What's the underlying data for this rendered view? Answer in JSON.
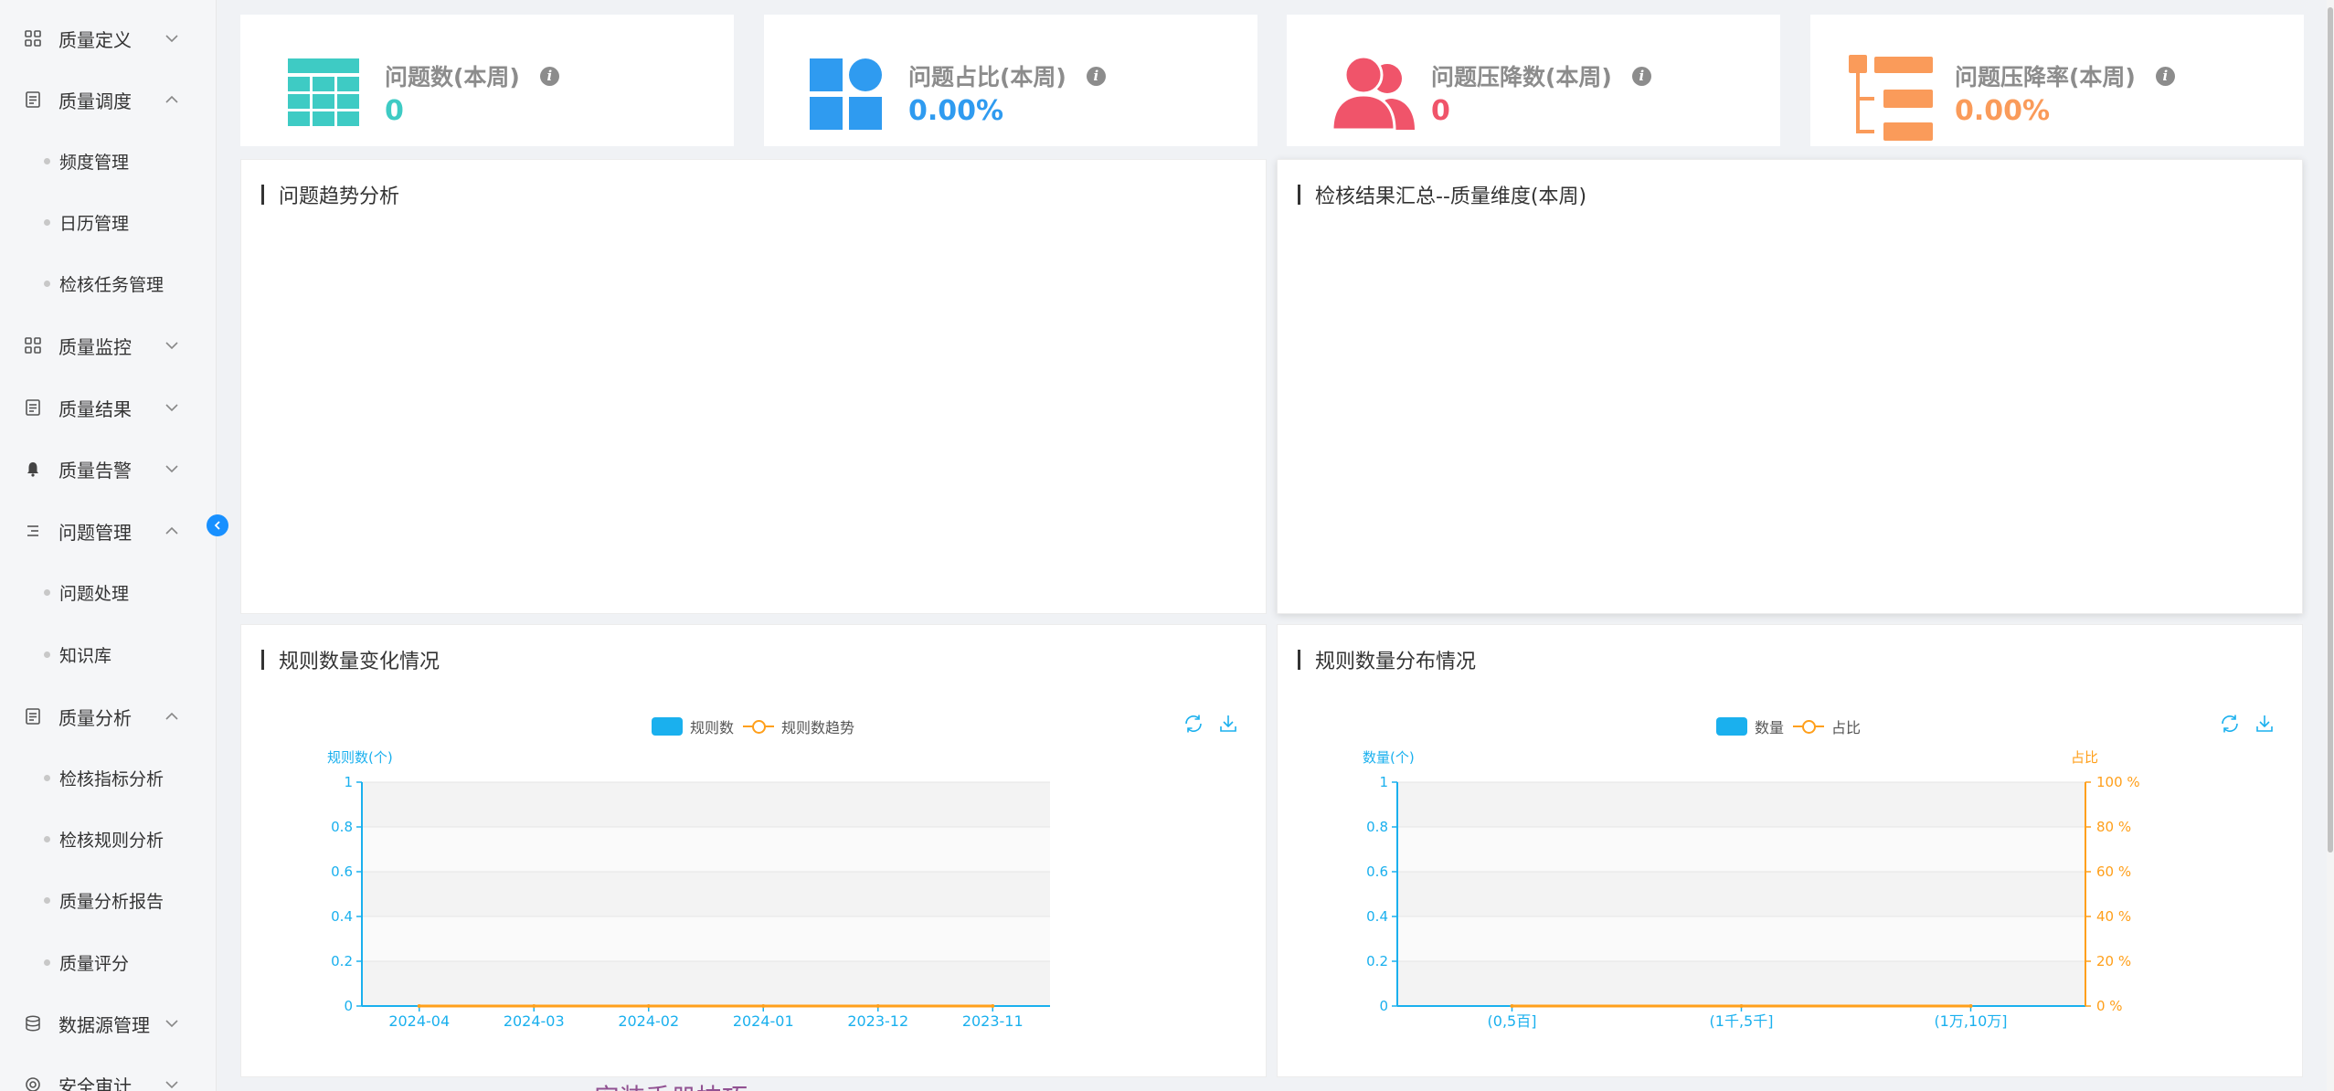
{
  "sidebar": {
    "items": [
      {
        "label": "质量定义",
        "icon": "grid-icon",
        "expanded": false
      },
      {
        "label": "质量调度",
        "icon": "document-icon",
        "expanded": true,
        "children": [
          "频度管理",
          "日历管理",
          "检核任务管理"
        ]
      },
      {
        "label": "质量监控",
        "icon": "grid-icon",
        "expanded": false
      },
      {
        "label": "质量结果",
        "icon": "document-icon",
        "expanded": false
      },
      {
        "label": "质量告警",
        "icon": "bell-icon",
        "expanded": false
      },
      {
        "label": "问题管理",
        "icon": "list-indent-icon",
        "expanded": true,
        "children": [
          "问题处理",
          "知识库"
        ]
      },
      {
        "label": "质量分析",
        "icon": "document-icon",
        "expanded": true,
        "children": [
          "检核指标分析",
          "检核规则分析",
          "质量分析报告",
          "质量评分"
        ]
      },
      {
        "label": "数据源管理",
        "icon": "database-icon",
        "expanded": false
      },
      {
        "label": "安全审计",
        "icon": "audit-icon",
        "expanded": false
      }
    ]
  },
  "stats": [
    {
      "title": "问题数(本周)",
      "value": "0",
      "color": "#3ecbc4",
      "icon": "table-icon"
    },
    {
      "title": "问题占比(本周)",
      "value": "0.00%",
      "color": "#2f9bf0",
      "icon": "shapes-icon"
    },
    {
      "title": "问题压降数(本周)",
      "value": "0",
      "color": "#f0546a",
      "icon": "users-icon"
    },
    {
      "title": "问题压降率(本周)",
      "value": "0.00%",
      "color": "#fa9b5a",
      "icon": "tree-icon"
    }
  ],
  "panels": {
    "trend": {
      "title": "问题趋势分析"
    },
    "summary": {
      "title": "检核结果汇总--质量维度(本周)"
    },
    "rule_change": {
      "title": "规则数量变化情况"
    },
    "rule_dist": {
      "title": "规则数量分布情况"
    }
  },
  "chart_data": [
    {
      "type": "bar",
      "legend": [
        "规则数",
        "规则数趋势"
      ],
      "ylabel": "规则数(个)",
      "categories": [
        "2024-04",
        "2024-03",
        "2024-02",
        "2024-01",
        "2023-12",
        "2023-11"
      ],
      "series": [
        {
          "name": "规则数",
          "type": "bar",
          "values": [
            0,
            0,
            0,
            0,
            0,
            0
          ]
        },
        {
          "name": "规则数趋势",
          "type": "line",
          "values": [
            0,
            0,
            0,
            0,
            0,
            0
          ]
        }
      ],
      "ylim": [
        0,
        1
      ],
      "yticks": [
        "0",
        "0.2",
        "0.4",
        "0.6",
        "0.8",
        "1"
      ],
      "colors": {
        "bar": "#1ab0ee",
        "line": "#ff9f1a"
      }
    },
    {
      "type": "bar",
      "legend": [
        "数量",
        "占比"
      ],
      "ylabel": "数量(个)",
      "ylabel_right": "占比",
      "categories": [
        "(0,5百]",
        "(1千,5千]",
        "(1万,10万]"
      ],
      "series": [
        {
          "name": "数量",
          "type": "bar",
          "values": [
            0,
            0,
            0
          ]
        },
        {
          "name": "占比",
          "type": "line",
          "values": [
            0,
            0,
            0
          ]
        }
      ],
      "ylim": [
        0,
        1
      ],
      "yticks": [
        "0",
        "0.2",
        "0.4",
        "0.6",
        "0.8",
        "1"
      ],
      "yticks_right": [
        "0 %",
        "20 %",
        "40 %",
        "60 %",
        "80 %",
        "100 %"
      ],
      "colors": {
        "bar": "#1ab0ee",
        "line": "#ff9f1a"
      }
    }
  ],
  "watermark": "安装手册技巧"
}
